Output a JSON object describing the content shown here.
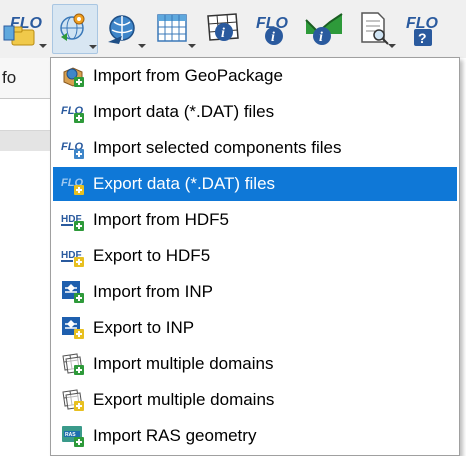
{
  "background_panel": {
    "header_label": "fo"
  },
  "toolbar": {
    "buttons": [
      {
        "name": "flo-open-button",
        "icon": "flo-folder-icon"
      },
      {
        "name": "import-export-button",
        "icon": "globe-gear-icon",
        "active": true
      },
      {
        "name": "globe-tool-button",
        "icon": "globe-arrow-icon"
      },
      {
        "name": "grid-table-button",
        "icon": "grid-table-icon"
      },
      {
        "name": "mesh-info-button",
        "icon": "mesh-info-icon"
      },
      {
        "name": "flo-info-button",
        "icon": "flo-info-icon"
      },
      {
        "name": "profile-info-button",
        "icon": "profile-info-icon"
      },
      {
        "name": "report-search-button",
        "icon": "report-search-icon"
      },
      {
        "name": "flo-help-button",
        "icon": "flo-help-icon"
      }
    ]
  },
  "menu": {
    "items": [
      {
        "label": "Import from GeoPackage",
        "icon": "geopackage-import-icon",
        "selected": false
      },
      {
        "label": "Import data (*.DAT) files",
        "icon": "flo-import-icon",
        "selected": false
      },
      {
        "label": "Import selected components files",
        "icon": "flo-import-components-icon",
        "selected": false
      },
      {
        "label": "Export data (*.DAT) files",
        "icon": "flo-export-icon",
        "selected": true
      },
      {
        "label": "Import from HDF5",
        "icon": "hdf5-import-icon",
        "selected": false
      },
      {
        "label": "Export to HDF5",
        "icon": "hdf5-export-icon",
        "selected": false
      },
      {
        "label": "Import from INP",
        "icon": "inp-import-icon",
        "selected": false
      },
      {
        "label": "Export to INP",
        "icon": "inp-export-icon",
        "selected": false
      },
      {
        "label": "Import multiple domains",
        "icon": "multi-domain-import-icon",
        "selected": false
      },
      {
        "label": "Export multiple domains",
        "icon": "multi-domain-export-icon",
        "selected": false
      },
      {
        "label": "Import RAS geometry",
        "icon": "ras-import-icon",
        "selected": false
      }
    ]
  },
  "colors": {
    "selection": "#0f78d7",
    "flo_blue": "#2a5a9e",
    "import_green": "#2e9a3a",
    "export_yellow": "#e8c020"
  }
}
